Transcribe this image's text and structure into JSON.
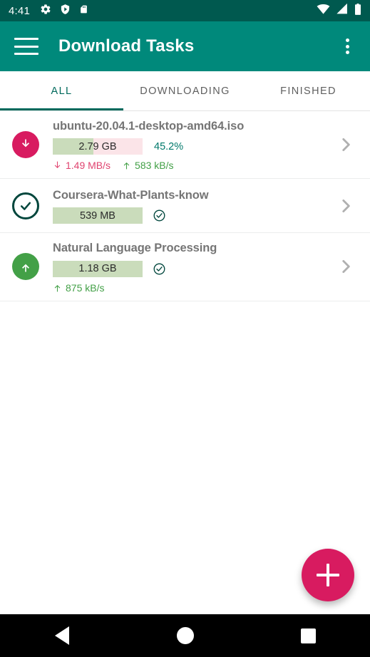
{
  "status_bar": {
    "time": "4:41",
    "left_icons": [
      "gear-icon",
      "shield-play-icon",
      "sd-card-icon"
    ],
    "right_icons": [
      "wifi-icon",
      "cellular-signal-icon",
      "battery-icon"
    ],
    "background": "#00594f"
  },
  "app_bar": {
    "menu_icon": "hamburger-menu-icon",
    "title": "Download Tasks",
    "overflow_icon": "overflow-menu-icon",
    "background": "#00897b"
  },
  "tabs": {
    "items": [
      {
        "label": "ALL",
        "active": true
      },
      {
        "label": "DOWNLOADING",
        "active": false
      },
      {
        "label": "FINISHED",
        "active": false
      }
    ],
    "active_color": "#00695c",
    "inactive_color": "#5f5f5f"
  },
  "tasks": [
    {
      "title": "ubuntu-20.04.1-desktop-amd64.iso",
      "status": "downloading",
      "status_icon": "download-arrow-circle-icon",
      "status_icon_color": "#d81b60",
      "size": "2.79 GB",
      "percent_label": "45.2%",
      "percent_value": 45.2,
      "complete": false,
      "download_speed": "1.49 MB/s",
      "upload_speed": "583 kB/s",
      "chevron_icon": "chevron-right-icon"
    },
    {
      "title": "Coursera-What-Plants-know",
      "status": "finished",
      "status_icon": "check-circle-outline-icon",
      "status_icon_color": "#00463c",
      "size": "539 MB",
      "percent_label": "",
      "percent_value": 100,
      "complete": true,
      "download_speed": "",
      "upload_speed": "",
      "chevron_icon": "chevron-right-icon"
    },
    {
      "title": "Natural Language Processing",
      "status": "seeding",
      "status_icon": "upload-arrow-circle-icon",
      "status_icon_color": "#43a047",
      "size": "1.18 GB",
      "percent_label": "",
      "percent_value": 100,
      "complete": true,
      "download_speed": "",
      "upload_speed": "875 kB/s",
      "chevron_icon": "chevron-right-icon"
    }
  ],
  "fab": {
    "icon": "plus-icon",
    "color": "#d81b60"
  },
  "nav_bar": {
    "back": "back-triangle-icon",
    "home": "home-circle-icon",
    "recents": "recents-square-icon"
  },
  "colors": {
    "progress_done": "#cadcbb",
    "progress_remaining": "#fbe4e8",
    "accent": "#00897b",
    "pink": "#d81b60",
    "green": "#43a047"
  }
}
